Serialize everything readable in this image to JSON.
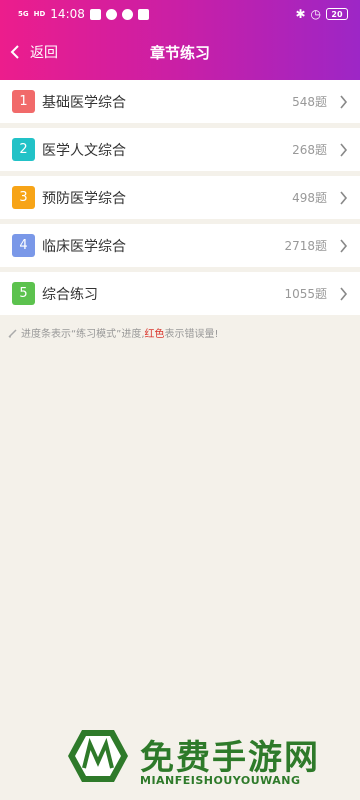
{
  "status_bar": {
    "signal": "5G",
    "hd": "HD",
    "time": "14:08",
    "battery": "20",
    "icons": [
      "signal-icon",
      "hd-icon",
      "notification-icons",
      "bluetooth-icon",
      "alarm-icon",
      "battery-icon"
    ]
  },
  "nav": {
    "back_label": "返回",
    "title": "章节练习"
  },
  "chapters": [
    {
      "num": "1",
      "title": "基础医学综合",
      "count": "548题",
      "color": "#f16a6a"
    },
    {
      "num": "2",
      "title": "医学人文综合",
      "count": "268题",
      "color": "#22c2c7"
    },
    {
      "num": "3",
      "title": "预防医学综合",
      "count": "498题",
      "color": "#f7a417"
    },
    {
      "num": "4",
      "title": "临床医学综合",
      "count": "2718题",
      "color": "#7a98e8"
    },
    {
      "num": "5",
      "title": "综合练习",
      "count": "1055题",
      "color": "#5cc24e"
    }
  ],
  "note": {
    "prefix": "进度条表示“练习模式”进度,",
    "red": "红色",
    "suffix": "表示错误量!"
  },
  "watermark": {
    "title": "免费手游网",
    "subtitle": "MIANFEISHOUYOUWANG"
  },
  "colors": {
    "header_start": "#ec1d8c",
    "header_end": "#9d26c6",
    "background": "#f4f1ea"
  }
}
